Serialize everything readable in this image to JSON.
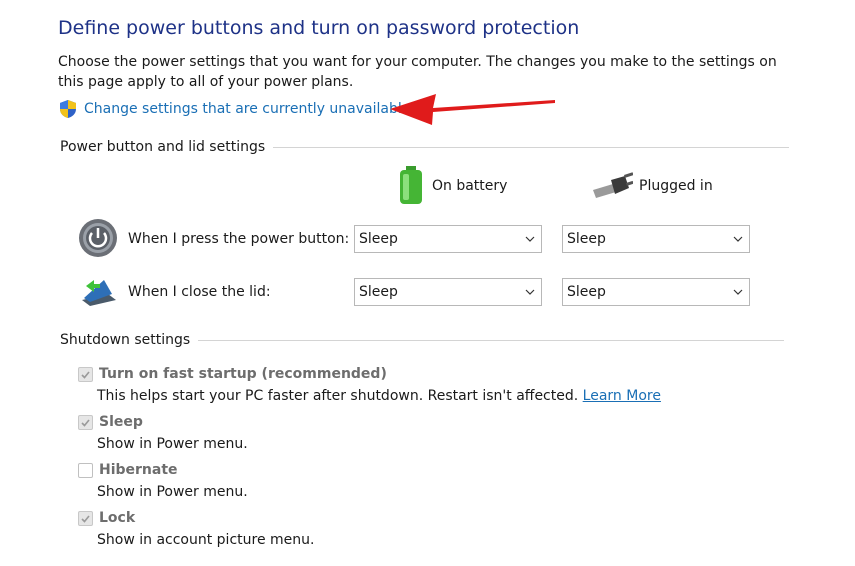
{
  "header": {
    "title": "Define power buttons and turn on password protection",
    "description": "Choose the power settings that you want for your computer. The changes you make to the settings on this page apply to all of your power plans.",
    "change_link": "Change settings that are currently unavailable"
  },
  "power_section": {
    "label": "Power button and lid settings",
    "columns": {
      "battery": "On battery",
      "plugged": "Plugged in"
    },
    "rows": [
      {
        "label": "When I press the power button:",
        "battery": "Sleep",
        "plugged": "Sleep"
      },
      {
        "label": "When I close the lid:",
        "battery": "Sleep",
        "plugged": "Sleep"
      }
    ]
  },
  "shutdown_section": {
    "label": "Shutdown settings",
    "items": [
      {
        "label": "Turn on fast startup (recommended)",
        "desc": "This helps start your PC faster after shutdown. Restart isn't affected.",
        "link": "Learn More",
        "checked": true
      },
      {
        "label": "Sleep",
        "desc": "Show in Power menu.",
        "checked": true
      },
      {
        "label": "Hibernate",
        "desc": "Show in Power menu.",
        "checked": false
      },
      {
        "label": "Lock",
        "desc": "Show in account picture menu.",
        "checked": true
      }
    ]
  },
  "colors": {
    "title": "#1e3287",
    "link": "#1a6fb5",
    "arrow": "#e01b1b",
    "disabled_text": "#6d6d6d"
  }
}
